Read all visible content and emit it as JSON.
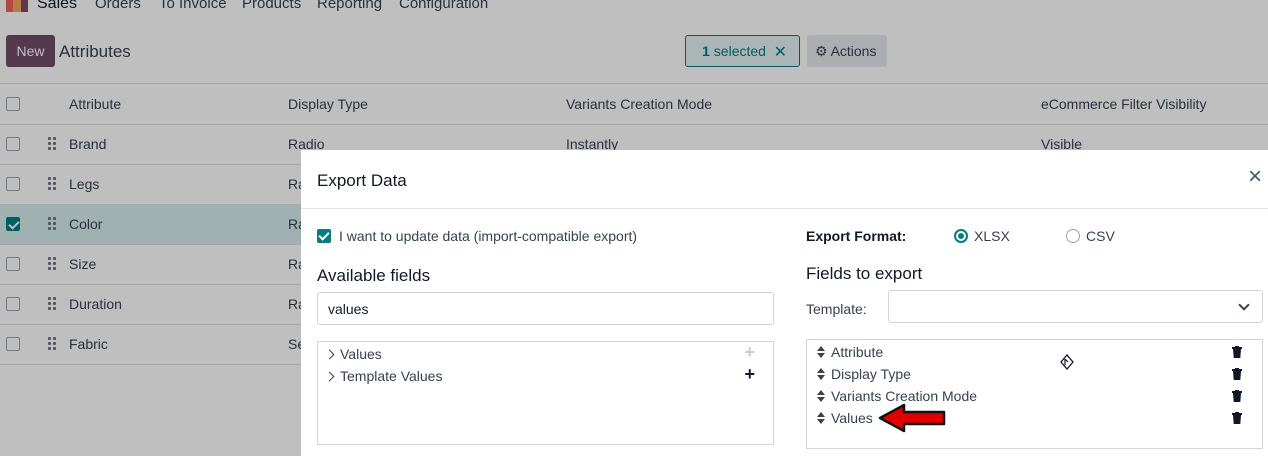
{
  "nav": {
    "brand": "Sales",
    "items": [
      "Orders",
      "To Invoice",
      "Products",
      "Reporting",
      "Configuration"
    ],
    "logo_colors": [
      "#f06050",
      "#f4a460",
      "#6cc1ed",
      "#814968"
    ]
  },
  "control": {
    "new_label": "New",
    "title": "Attributes",
    "selected_count": "1",
    "selected_label": "selected",
    "clear_icon": "close-icon",
    "actions_label": "Actions"
  },
  "list": {
    "headers": [
      "Attribute",
      "Display Type",
      "Variants Creation Mode",
      "eCommerce Filter Visibility"
    ],
    "rows": [
      {
        "attribute": "Brand",
        "display_type": "Radio",
        "mode": "Instantly",
        "visibility": "Visible",
        "selected": false
      },
      {
        "attribute": "Legs",
        "display_type": "Ra",
        "mode": "",
        "visibility": "",
        "selected": false
      },
      {
        "attribute": "Color",
        "display_type": "Ra",
        "mode": "",
        "visibility": "",
        "selected": true
      },
      {
        "attribute": "Size",
        "display_type": "Ra",
        "mode": "",
        "visibility": "",
        "selected": false
      },
      {
        "attribute": "Duration",
        "display_type": "Ra",
        "mode": "",
        "visibility": "",
        "selected": false
      },
      {
        "attribute": "Fabric",
        "display_type": "Se",
        "mode": "",
        "visibility": "",
        "selected": false
      }
    ]
  },
  "dialog": {
    "title": "Export Data",
    "import_compatible_label": "I want to update data (import-compatible export)",
    "import_compatible_checked": true,
    "available_title": "Available fields",
    "search_value": "values",
    "available_fields": [
      {
        "label": "Values",
        "plus_enabled": false
      },
      {
        "label": "Template Values",
        "plus_enabled": true
      }
    ],
    "format_label": "Export Format:",
    "formats": [
      {
        "label": "XLSX",
        "checked": true
      },
      {
        "label": "CSV",
        "checked": false
      }
    ],
    "fields_to_export_title": "Fields to export",
    "template_label": "Template:",
    "template_value": "",
    "export_fields": [
      "Attribute",
      "Display Type",
      "Variants Creation Mode",
      "Values"
    ]
  },
  "colors": {
    "primary": "#714b67",
    "accent": "#017e84",
    "arrow": "#e00000"
  }
}
